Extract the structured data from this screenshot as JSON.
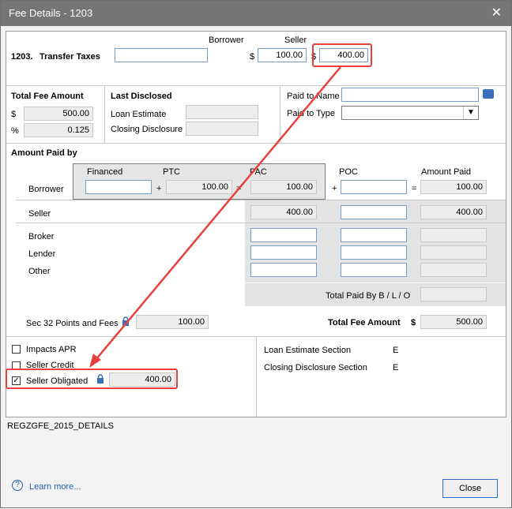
{
  "window": {
    "title": "Fee Details - 1203"
  },
  "header": {
    "line_number": "1203.",
    "line_name": "Transfer Taxes",
    "description_value": "",
    "borrower_label": "Borrower",
    "seller_label": "Seller",
    "currency": "$",
    "borrower_amount": "100.00",
    "seller_amount": "400.00"
  },
  "total_fee": {
    "title": "Total Fee Amount",
    "dollar_symbol": "$",
    "percent_symbol": "%",
    "amount": "500.00",
    "percent": "0.125"
  },
  "last_disclosed": {
    "title": "Last Disclosed",
    "loan_estimate_label": "Loan Estimate",
    "closing_disclosure_label": "Closing Disclosure",
    "loan_estimate_value": "",
    "closing_disclosure_value": ""
  },
  "paid_to": {
    "name_label": "Paid to Name",
    "type_label": "Paid to Type",
    "name_value": "",
    "type_value": ""
  },
  "amount_paid_by": {
    "title": "Amount Paid by",
    "columns": {
      "financed": "Financed",
      "ptc": "PTC",
      "pac": "PAC",
      "poc": "POC",
      "amount_paid": "Amount Paid"
    },
    "plus": "+",
    "equals": "=",
    "borrower": {
      "label": "Borrower",
      "financed": "",
      "ptc": "100.00",
      "pac": "100.00",
      "poc": "",
      "amount_paid": "100.00"
    },
    "seller": {
      "label": "Seller",
      "pac": "400.00",
      "poc": "",
      "amount_paid": "400.00"
    },
    "broker": {
      "label": "Broker",
      "pac": "",
      "poc": "",
      "amount_paid": ""
    },
    "lender": {
      "label": "Lender",
      "pac": "",
      "poc": "",
      "amount_paid": ""
    },
    "other": {
      "label": "Other",
      "pac": "",
      "poc": "",
      "amount_paid": ""
    },
    "total_paid_blo_label": "Total Paid By B / L / O",
    "total_paid_blo_value": ""
  },
  "sec32": {
    "label": "Sec 32 Points and Fees",
    "value": "100.00"
  },
  "total_fee_bottom": {
    "label": "Total Fee Amount",
    "currency": "$",
    "value": "500.00"
  },
  "options": {
    "impacts_apr": {
      "label": "Impacts APR",
      "checked": false
    },
    "seller_credit": {
      "label": "Seller Credit",
      "checked": false
    },
    "seller_obligated": {
      "label": "Seller Obligated",
      "checked": true,
      "value": "400.00"
    }
  },
  "sections": {
    "loan_estimate_label": "Loan Estimate Section",
    "loan_estimate_value": "E",
    "closing_disclosure_label": "Closing Disclosure Section",
    "closing_disclosure_value": "E"
  },
  "form_id": "REGZGFE_2015_DETAILS",
  "footer": {
    "learn_more": "Learn more...",
    "close": "Close"
  },
  "colors": {
    "title_bar": "#757575",
    "highlight": "#e8403d",
    "input_border": "#7a9cc6",
    "link": "#1f5fb3"
  }
}
